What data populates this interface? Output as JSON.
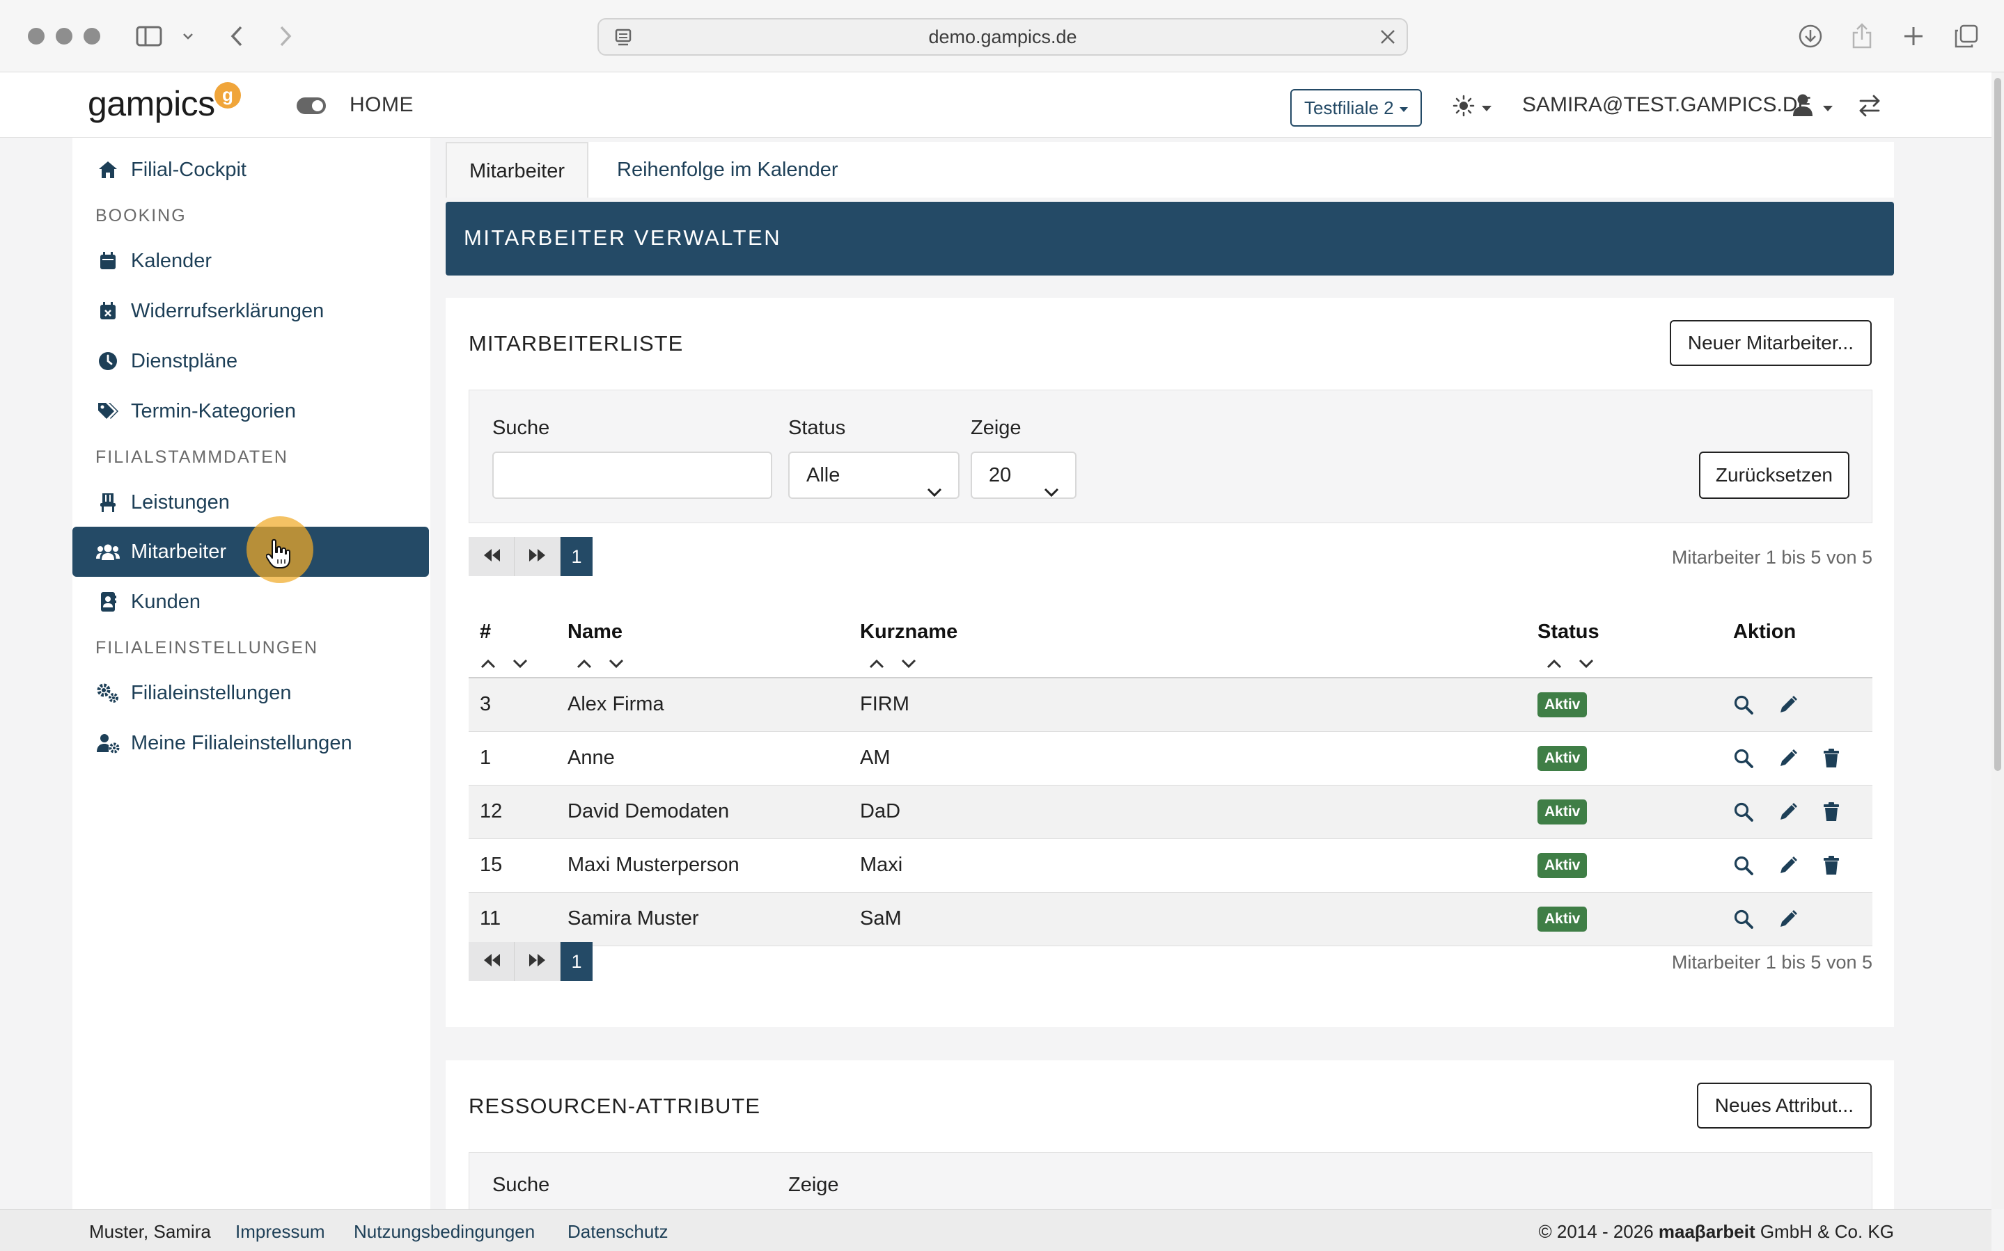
{
  "browser": {
    "url": "demo.gampics.de"
  },
  "header": {
    "logo_text": "gampics",
    "logo_badge": "g",
    "home_label": "HOME",
    "branch_select": "Testfiliale 2",
    "user_email": "SAMIRA@TEST.GAMPICS.DE"
  },
  "sidebar": {
    "cockpit": "Filial-Cockpit",
    "section_booking": "BOOKING",
    "calendar": "Kalender",
    "revocations": "Widerrufserklärungen",
    "rosters": "Dienstpläne",
    "categories": "Termin-Kategorien",
    "section_master": "FILIALSTAMMDATEN",
    "services": "Leistungen",
    "employees": "Mitarbeiter",
    "customers": "Kunden",
    "section_settings": "FILIALEINSTELLUNGEN",
    "branch_settings": "Filialeinstellungen",
    "my_branch_settings": "Meine Filialeinstellungen"
  },
  "tabs": {
    "employees": "Mitarbeiter",
    "calendar_order": "Reihenfolge im Kalender"
  },
  "banner_title": "MITARBEITER VERWALTEN",
  "employee_list": {
    "title": "MITARBEITERLISTE",
    "new_button": "Neuer Mitarbeiter...",
    "filter": {
      "search_label": "Suche",
      "search_value": "",
      "status_label": "Status",
      "status_value": "Alle",
      "show_label": "Zeige",
      "show_value": "20",
      "reset_button": "Zurücksetzen"
    },
    "current_page": "1",
    "pager_info": "Mitarbeiter 1 bis 5 von 5",
    "columns": {
      "id": "#",
      "name": "Name",
      "short": "Kurzname",
      "status": "Status",
      "action": "Aktion"
    },
    "rows": [
      {
        "id": "3",
        "name": "Alex Firma",
        "short": "FIRM",
        "status": "Aktiv",
        "deletable": false
      },
      {
        "id": "1",
        "name": "Anne",
        "short": "AM",
        "status": "Aktiv",
        "deletable": true
      },
      {
        "id": "12",
        "name": "David Demodaten",
        "short": "DaD",
        "status": "Aktiv",
        "deletable": true
      },
      {
        "id": "15",
        "name": "Maxi Musterperson",
        "short": "Maxi",
        "status": "Aktiv",
        "deletable": true
      },
      {
        "id": "11",
        "name": "Samira Muster",
        "short": "SaM",
        "status": "Aktiv",
        "deletable": false
      }
    ]
  },
  "resource_attributes": {
    "title": "RESSOURCEN-ATTRIBUTE",
    "new_button": "Neues Attribut...",
    "search_label": "Suche",
    "show_label": "Zeige"
  },
  "footer": {
    "user": "Muster, Samira",
    "imprint": "Impressum",
    "terms": "Nutzungsbedingungen",
    "privacy": "Datenschutz",
    "copyright_prefix": "© 2014 - 2026 ",
    "copyright_brand": "maaβarbeit",
    "copyright_suffix": " GmbH & Co. KG"
  },
  "colors": {
    "primary": "#244a66",
    "badge_active": "#3f7e46",
    "logo_accent": "#f0a53a"
  }
}
